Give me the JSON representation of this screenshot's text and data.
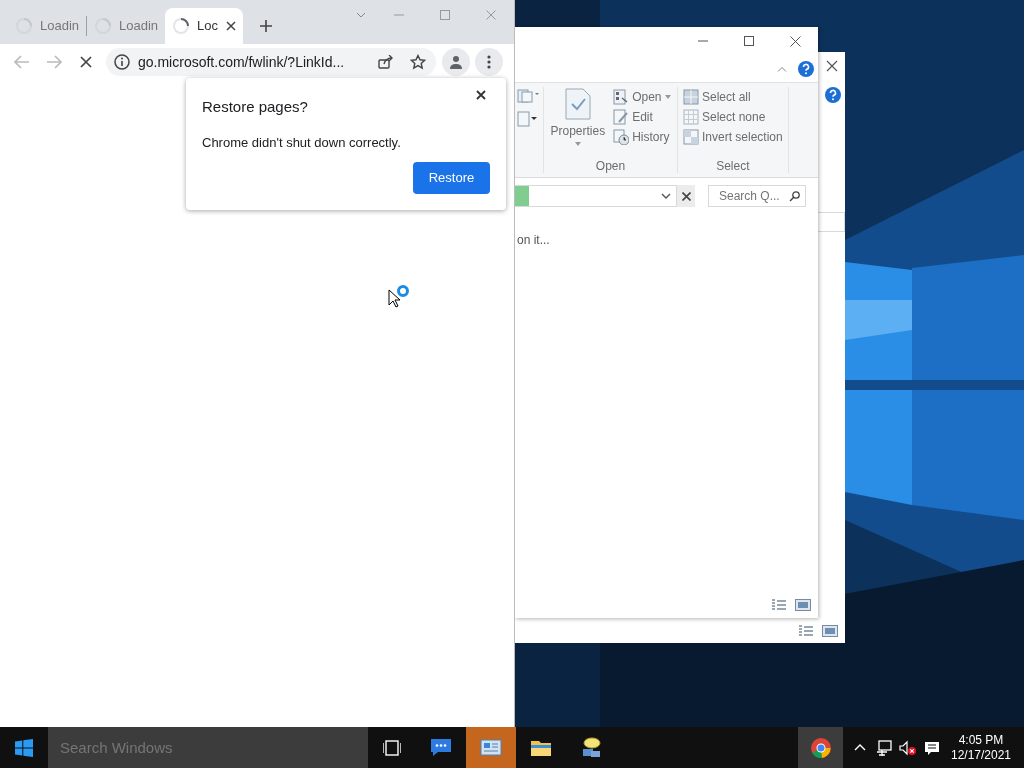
{
  "browser": {
    "tabs": [
      {
        "title": "Loadin",
        "selected": false,
        "loading": true
      },
      {
        "title": "Loadin",
        "selected": false,
        "loading": true
      },
      {
        "title": "Loc",
        "selected": true,
        "loading": true
      }
    ],
    "address": "go.microsoft.com/fwlink/?LinkId...",
    "dialog": {
      "title": "Restore pages?",
      "message": "Chrome didn't shut down correctly.",
      "button": "Restore"
    }
  },
  "explorer": {
    "ribbon_groups": [
      {
        "label": "Open",
        "large": {
          "label": "Properties",
          "dropdown": true
        },
        "items": [
          {
            "label": "Open",
            "kind": "open",
            "dropdown": true
          },
          {
            "label": "Edit",
            "kind": "edit",
            "dropdown": false
          },
          {
            "label": "History",
            "kind": "history",
            "dropdown": false
          }
        ]
      },
      {
        "label": "Select",
        "items": [
          {
            "label": "Select all",
            "kind": "select-all",
            "dropdown": false
          },
          {
            "label": "Select none",
            "kind": "select-none",
            "dropdown": false
          },
          {
            "label": "Invert selection",
            "kind": "invert",
            "dropdown": false
          }
        ]
      }
    ],
    "search_placeholder": "Search Q...",
    "content_text": "on it..."
  },
  "taskbar": {
    "search_placeholder": "Search Windows",
    "apps": [
      {
        "kind": "chat",
        "selected": false,
        "flashing": false
      },
      {
        "kind": "panel",
        "selected": false,
        "flashing": true
      },
      {
        "kind": "folder",
        "selected": false,
        "flashing": false
      },
      {
        "kind": "messenger",
        "selected": false,
        "flashing": false
      },
      {
        "kind": "chrome",
        "selected": true,
        "flashing": false
      }
    ],
    "volume_muted": true,
    "time": "4:05 PM",
    "date": "12/17/2021"
  }
}
